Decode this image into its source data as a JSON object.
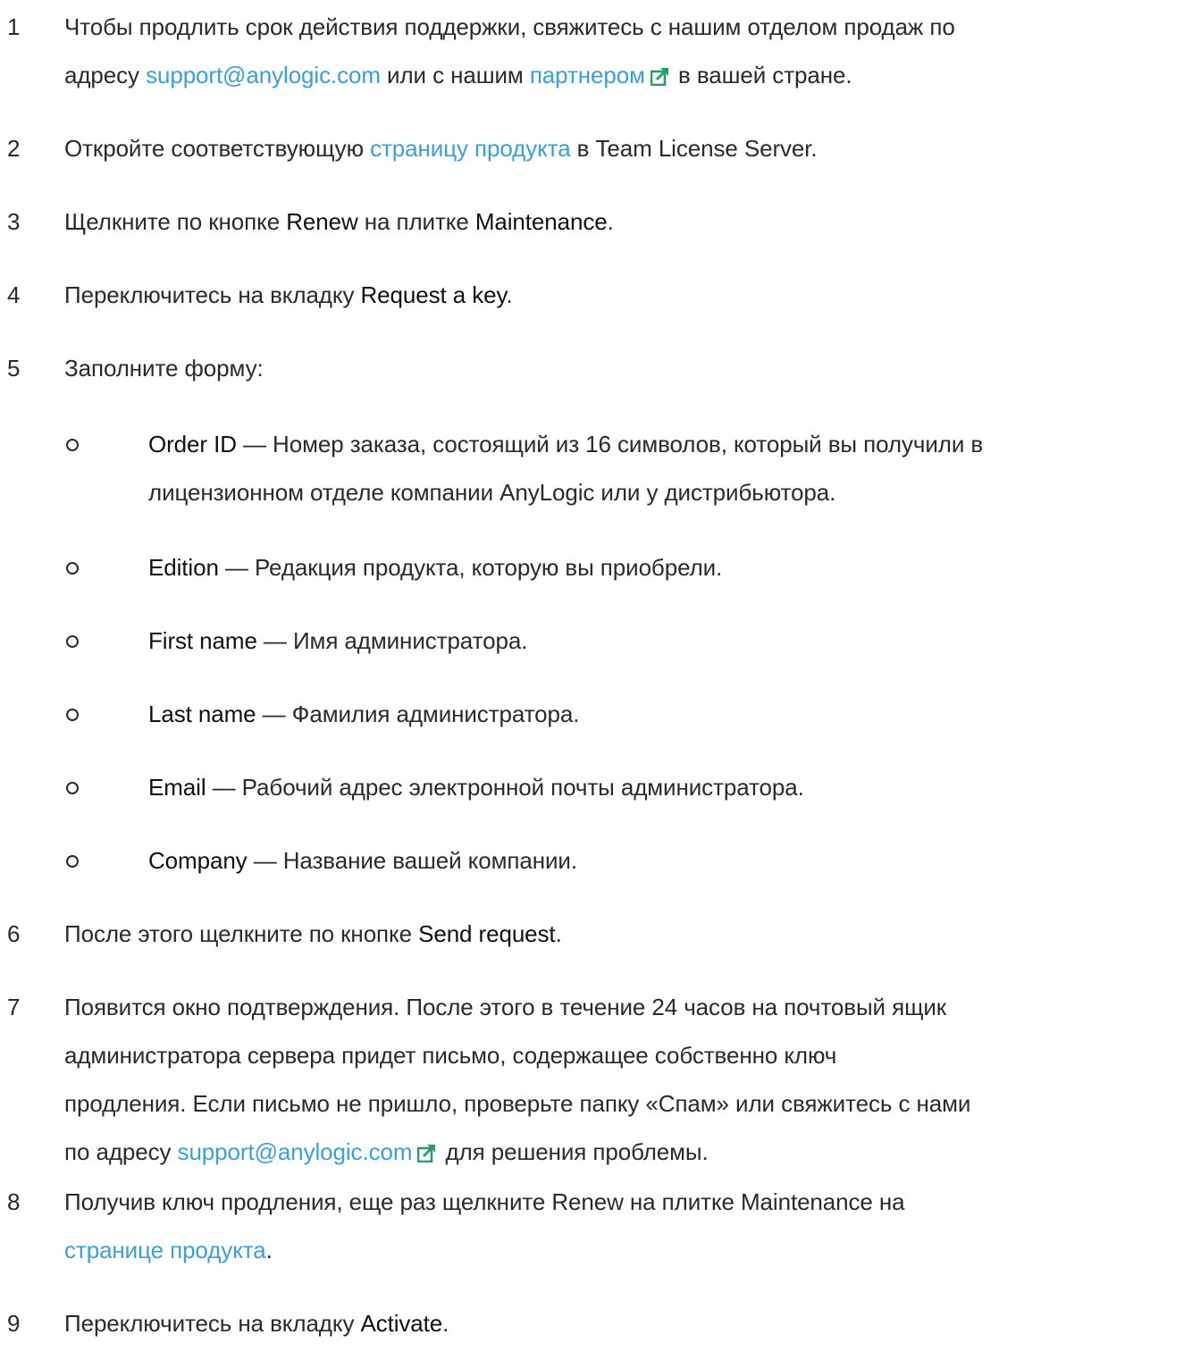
{
  "steps": [
    {
      "num": "1",
      "line1_text": "Чтобы продлить срок действия поддержки, свяжитесь с нашим отделом продаж по",
      "line2_prefix": "адресу ",
      "email_link": "support@anylogic.com",
      "line2_middle": " или с нашим ",
      "partner_link": "партнером",
      "line2_suffix": " в вашей стране."
    },
    {
      "num": "2",
      "prefix": "Откройте соответствующую ",
      "link": "страницу продукта",
      "suffix": " в Team License Server."
    },
    {
      "num": "3",
      "prefix": "Щелкните по кнопке ",
      "ui1": "Renew",
      "middle": " на плитке ",
      "ui2": "Maintenance",
      "suffix": "."
    },
    {
      "num": "4",
      "prefix": "Переключитесь на вкладку ",
      "ui1": "Request a key",
      "suffix": "."
    },
    {
      "num": "5",
      "text": "Заполните форму:",
      "fields": [
        {
          "name": "Order ID",
          "line1": " — Номер заказа, состоящий из 16 символов, который вы получили в",
          "line2": "лицензионном отделе компании AnyLogic или у дистрибьютора."
        },
        {
          "name": "Edition",
          "desc": " — Редакция продукта, которую вы приобрели."
        },
        {
          "name": "First name",
          "desc": " — Имя администратора."
        },
        {
          "name": "Last name",
          "desc": " — Фамилия администратора."
        },
        {
          "name": "Email",
          "desc": " — Рабочий адрес электронной почты администратора."
        },
        {
          "name": "Company",
          "desc": " — Название вашей компании."
        }
      ]
    },
    {
      "num": "6",
      "prefix": "После этого щелкните по кнопке ",
      "ui1": "Send request",
      "suffix": "."
    },
    {
      "num": "7",
      "line1": "Появится окно подтверждения. После этого в течение 24 часов на почтовый ящик",
      "line2": "администратора сервера придет письмо, содержащее собственно ключ",
      "line3": "продления. Если письмо не пришло, проверьте папку «Спам» или свяжитесь с нами",
      "line4_prefix": "по адресу ",
      "email_link": "support@anylogic.com",
      "line4_suffix": " для решения проблемы."
    },
    {
      "num": "8",
      "line1": "Получив ключ продления, еще раз щелкните Renew на плитке Maintenance на",
      "link": "странице продукта",
      "suffix": "."
    },
    {
      "num": "9",
      "prefix": "Переключитесь на вкладку ",
      "ui1": "Activate",
      "suffix": "."
    }
  ],
  "colors": {
    "text": "#2a2a2a",
    "link": "#3aa0d8",
    "icon": "#2a9d6a"
  },
  "icons": {
    "external_link": "external-link-icon"
  }
}
